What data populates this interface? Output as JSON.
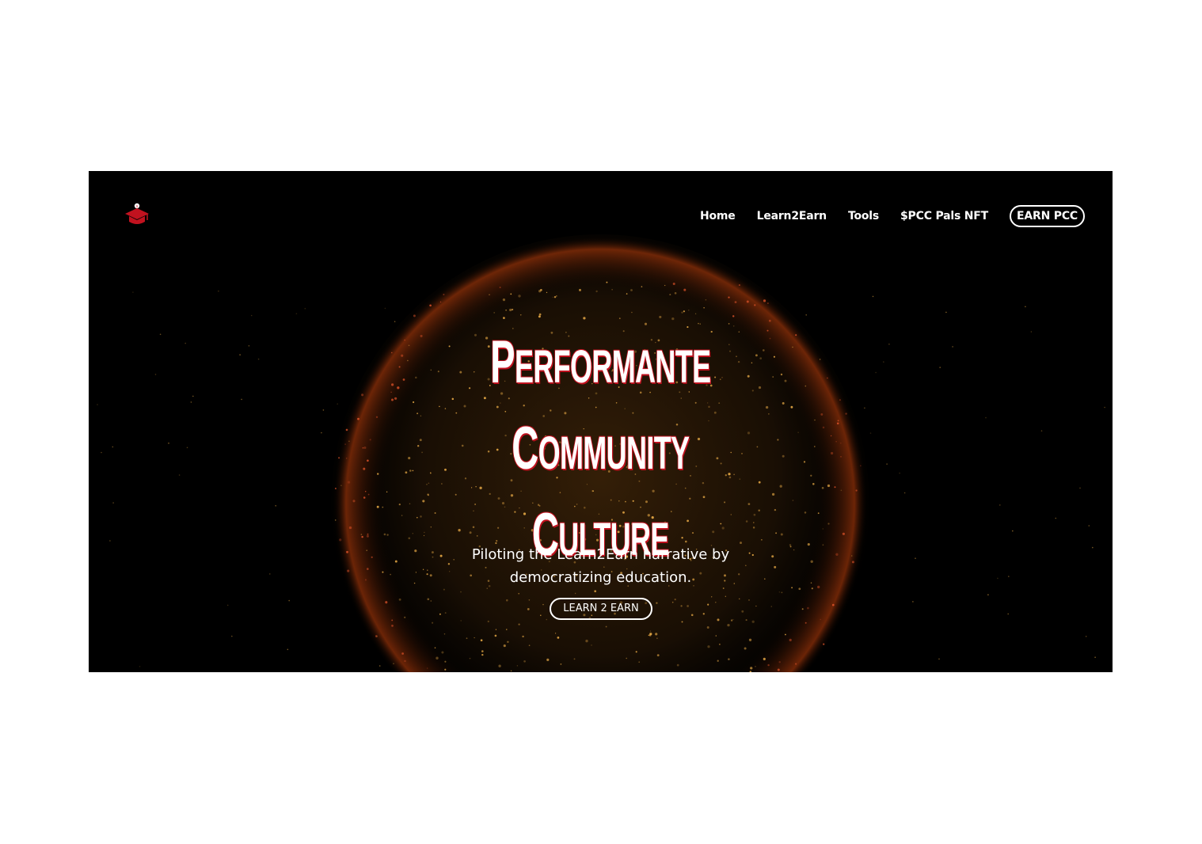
{
  "nav": {
    "logo_icon": "graduation-cap-icon",
    "links": [
      "Home",
      "Learn2Earn",
      "Tools",
      "$PCC Pals NFT"
    ],
    "cta_label": "EARN PCC"
  },
  "hero": {
    "headline": [
      {
        "cap": "P",
        "rest": "ERFORMANTE"
      },
      {
        "cap": "C",
        "rest": "OMMUNITY"
      },
      {
        "cap": "C",
        "rest": "ULTURE"
      }
    ],
    "subtitle_line1": "Piloting the Learn2Earn narrative by",
    "subtitle_line2": "democratizing education.",
    "cta_label": "LEARN 2 EARN"
  },
  "colors": {
    "background": "#000000",
    "accent": "#c1121f",
    "globe_glow": "#f2a23a"
  }
}
